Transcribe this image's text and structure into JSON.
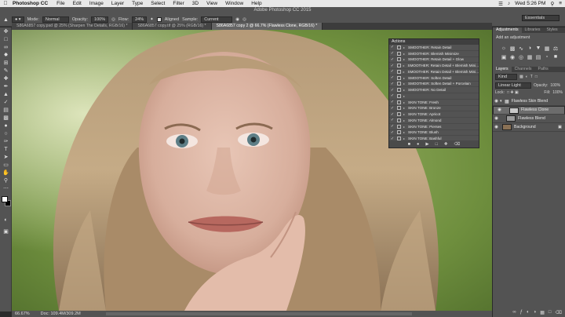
{
  "menubar": {
    "app": "Photoshop CC",
    "menus": [
      "File",
      "Edit",
      "Image",
      "Layer",
      "Type",
      "Select",
      "Filter",
      "3D",
      "View",
      "Window",
      "Help"
    ],
    "clock": "Wed 5:26 PM"
  },
  "window_title": "Adobe Photoshop CC 2015",
  "options": {
    "mode_label": "Mode:",
    "mode_value": "Normal",
    "opacity_label": "Opacity:",
    "opacity_value": "100%",
    "flow_label": "Flow:",
    "flow_value": "24%",
    "aligned_label": "Aligned",
    "sample_label": "Sample:",
    "sample_value": "Current Layer",
    "workspace": "Essentials"
  },
  "tabs": [
    {
      "label": "S86A6857 copy.psd @ 25% (Sharpen The Details, RGB/16) *"
    },
    {
      "label": "S86A6857 copy.tif @ 25% (RGB/16) *"
    },
    {
      "label": "S86A6857 copy 2 @ 66.7% (Flawless Clone, RGB/16) *"
    }
  ],
  "statusbar": {
    "zoom": "66.67%",
    "doc": "Doc: 109.4M/309.2M"
  },
  "actions_panel": {
    "title": "Actions",
    "items": [
      {
        "label": "SMOOTHER: Retain Detail"
      },
      {
        "label": "SMOOTHER: Blemish Minimize"
      },
      {
        "label": "SMOOTHER: Retain Detail + Glow"
      },
      {
        "label": "SMOOTHER: Retain Detail + Blemish Mini..."
      },
      {
        "label": "SMOOTHER: Retain Detail + Blemish Mini..."
      },
      {
        "label": "SMOOTHER: Soften Detail"
      },
      {
        "label": "SMOOTHER: Soften Detail + Porcelain"
      },
      {
        "label": "SMOOTHER: No Detail"
      },
      {
        "label": ""
      },
      {
        "label": "SKIN TONE: Fresh"
      },
      {
        "label": "SKIN TONE: Bronze"
      },
      {
        "label": "SKIN TONE: Apricot"
      },
      {
        "label": "SKIN TONE: Almond"
      },
      {
        "label": "SKIN TONE: Pierses"
      },
      {
        "label": "SKIN TONE: Blush"
      },
      {
        "label": "SKIN TONE: Bashful"
      }
    ]
  },
  "adjustments_panel": {
    "tabs": [
      "Adjustments",
      "Libraries",
      "Styles"
    ],
    "subtitle": "Add an adjustment",
    "icons": [
      "brightness-icon",
      "levels-icon",
      "curves-icon",
      "exposure-icon",
      "vibrance-icon",
      "hue-icon",
      "colorbalance-icon",
      "bw-icon",
      "photofilter-icon",
      "channelmixer-icon",
      "lookup-icon",
      "invert-icon",
      "posterize-icon",
      "threshold-icon"
    ]
  },
  "layers_panel": {
    "tabs": [
      "Layers",
      "Channels",
      "Paths"
    ],
    "kind": "Kind",
    "blend_mode": "Linear Light",
    "opacity_label": "Opacity:",
    "opacity_value": "100%",
    "lock_label": "Lock:",
    "fill_label": "Fill:",
    "fill_value": "100%",
    "layers": [
      {
        "name": "Flawless Skin Blend",
        "type": "group"
      },
      {
        "name": "Flawless Clone",
        "type": "layer",
        "selected": true
      },
      {
        "name": "Flawless Blend",
        "type": "layer"
      },
      {
        "name": "Background",
        "type": "background"
      }
    ]
  }
}
